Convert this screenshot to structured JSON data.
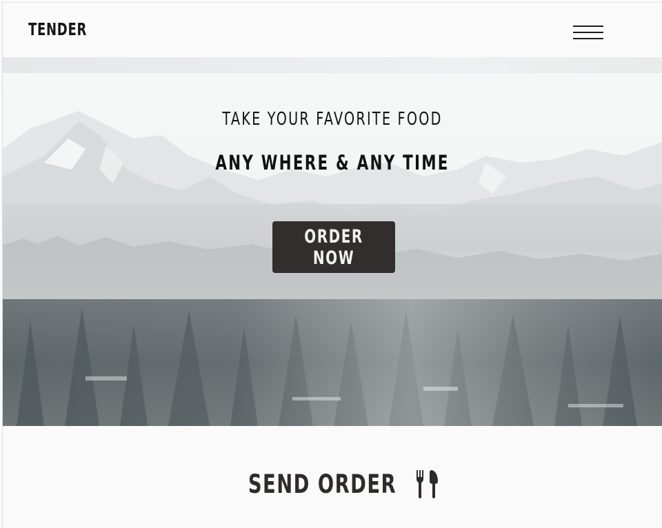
{
  "navbar": {
    "brand": "TENDER",
    "menu_icon": "hamburger-menu-icon"
  },
  "hero": {
    "tagline_line1": "TAKE YOUR FAVORITE FOOD",
    "tagline_line2": "ANY WHERE & ANY TIME",
    "cta_label": "ORDER NOW",
    "background": "snowy-mountain-forest-photo"
  },
  "send_order": {
    "title": "SEND ORDER",
    "icon": "fork-and-knife-icon"
  },
  "colors": {
    "button_bg": "#322e2e",
    "text_dark": "#151515",
    "page_bg": "#fafafa"
  }
}
